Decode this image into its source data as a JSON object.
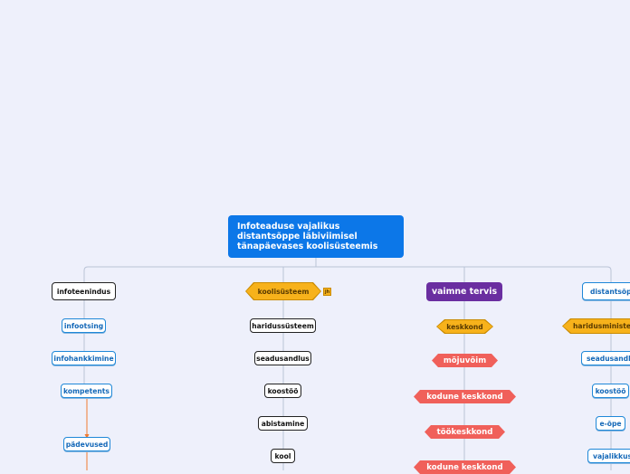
{
  "root": {
    "title": "Infoteaduse vajalikus distantsõppe läbiviimisel tänapäevases koolisüsteemis"
  },
  "branches": {
    "infoteenindus": {
      "label": "infoteenindus",
      "children": [
        "infootsing",
        "infohankkimine",
        "kompetents"
      ],
      "subchild": "pädevused"
    },
    "koolisusteem": {
      "label": "koolisüsteem",
      "tag": "jh",
      "children": [
        "haridussüsteem",
        "seadusandlus",
        "koostöö",
        "abistamine",
        "kool"
      ]
    },
    "vaimne": {
      "label": "vaimne tervis",
      "children": [
        "keskkond",
        "mõjuvõim",
        "kodune keskkond",
        "töökeskkond",
        "kodune keskkond"
      ]
    },
    "distants": {
      "label": "distantsõpe",
      "children": [
        "haridusministeerium",
        "seadusandlus",
        "koostöö",
        "e-õpe",
        "vajalikkus"
      ]
    }
  },
  "colors": {
    "background": "#eef0fb",
    "root": "#0c77e8",
    "blue_node": "#1f88d8",
    "orange": "#f7b21b",
    "purple": "#6a2ea0",
    "coral": "#f0605a",
    "connector": "#b9c3d6",
    "accent_line": "#f07a30"
  }
}
